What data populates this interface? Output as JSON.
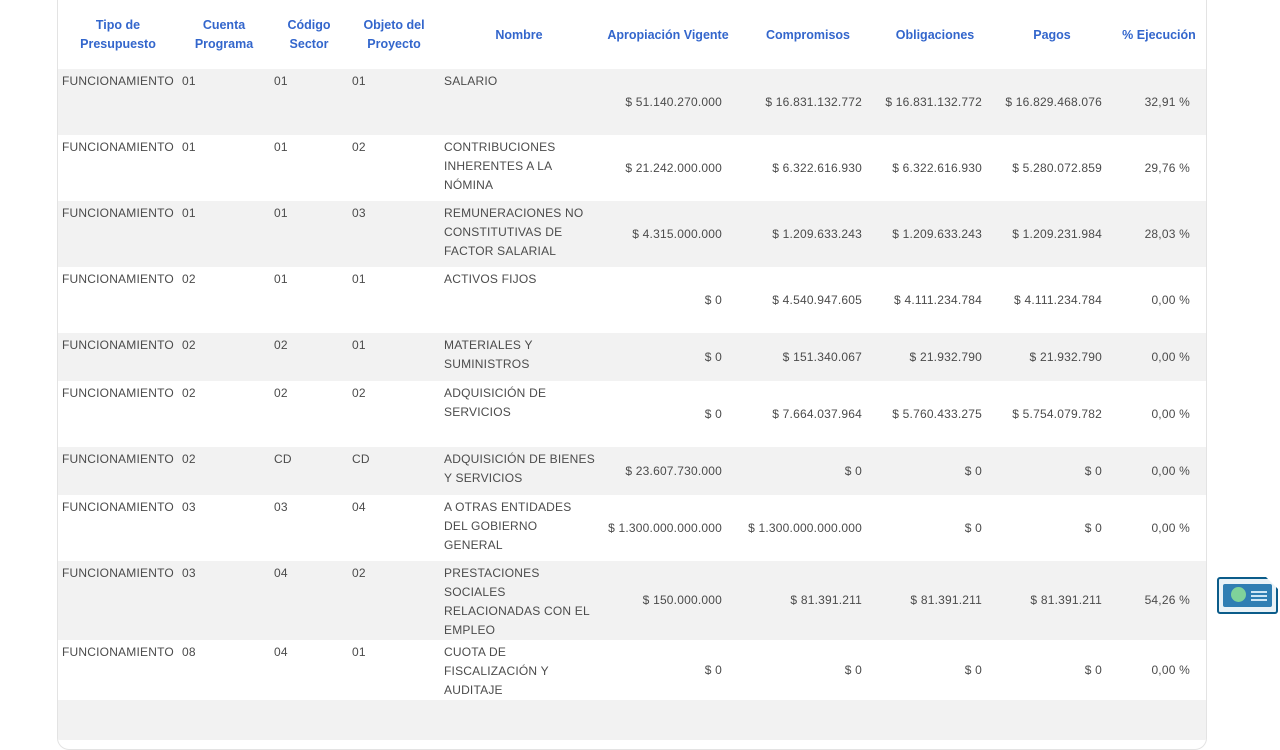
{
  "table": {
    "headers": [
      "Tipo de Presupuesto",
      "Cuenta Programa",
      "Código Sector",
      "Objeto del Proyecto",
      "Nombre",
      "Apropiación Vigente",
      "Compromisos",
      "Obligaciones",
      "Pagos",
      "% Ejecución"
    ],
    "rows": [
      {
        "tipo": "FUNCIONAMIENTO",
        "cuenta": "01",
        "sector": "01",
        "objeto": "01",
        "nombre": "SALARIO",
        "apropiacion": "$ 51.140.270.000",
        "compromisos": "$ 16.831.132.772",
        "obligaciones": "$ 16.831.132.772",
        "pagos": "$ 16.829.468.076",
        "ejecucion": "32,91 %"
      },
      {
        "tipo": "FUNCIONAMIENTO",
        "cuenta": "01",
        "sector": "01",
        "objeto": "02",
        "nombre": "CONTRIBUCIONES INHERENTES A LA NÓMINA",
        "apropiacion": "$ 21.242.000.000",
        "compromisos": "$ 6.322.616.930",
        "obligaciones": "$ 6.322.616.930",
        "pagos": "$ 5.280.072.859",
        "ejecucion": "29,76 %"
      },
      {
        "tipo": "FUNCIONAMIENTO",
        "cuenta": "01",
        "sector": "01",
        "objeto": "03",
        "nombre": "REMUNERACIONES NO CONSTITUTIVAS DE FACTOR SALARIAL",
        "apropiacion": "$ 4.315.000.000",
        "compromisos": "$ 1.209.633.243",
        "obligaciones": "$ 1.209.633.243",
        "pagos": "$ 1.209.231.984",
        "ejecucion": "28,03 %"
      },
      {
        "tipo": "FUNCIONAMIENTO",
        "cuenta": "02",
        "sector": "01",
        "objeto": "01",
        "nombre": "ACTIVOS FIJOS",
        "apropiacion": "$ 0",
        "compromisos": "$ 4.540.947.605",
        "obligaciones": "$ 4.111.234.784",
        "pagos": "$ 4.111.234.784",
        "ejecucion": "0,00 %"
      },
      {
        "tipo": "FUNCIONAMIENTO",
        "cuenta": "02",
        "sector": "02",
        "objeto": "01",
        "nombre": "MATERIALES Y SUMINISTROS",
        "apropiacion": "$ 0",
        "compromisos": "$ 151.340.067",
        "obligaciones": "$ 21.932.790",
        "pagos": "$ 21.932.790",
        "ejecucion": "0,00 %"
      },
      {
        "tipo": "FUNCIONAMIENTO",
        "cuenta": "02",
        "sector": "02",
        "objeto": "02",
        "nombre": "ADQUISICIÓN DE SERVICIOS",
        "apropiacion": "$ 0",
        "compromisos": "$ 7.664.037.964",
        "obligaciones": "$ 5.760.433.275",
        "pagos": "$ 5.754.079.782",
        "ejecucion": "0,00 %"
      },
      {
        "tipo": "FUNCIONAMIENTO",
        "cuenta": "02",
        "sector": "CD",
        "objeto": "CD",
        "nombre": "ADQUISICIÓN DE BIENES Y SERVICIOS",
        "apropiacion": "$ 23.607.730.000",
        "compromisos": "$ 0",
        "obligaciones": "$ 0",
        "pagos": "$ 0",
        "ejecucion": "0,00 %"
      },
      {
        "tipo": "FUNCIONAMIENTO",
        "cuenta": "03",
        "sector": "03",
        "objeto": "04",
        "nombre": "A OTRAS ENTIDADES DEL GOBIERNO GENERAL",
        "apropiacion": "$ 1.300.000.000.000",
        "compromisos": "$ 1.300.000.000.000",
        "obligaciones": "$ 0",
        "pagos": "$ 0",
        "ejecucion": "0,00 %"
      },
      {
        "tipo": "FUNCIONAMIENTO",
        "cuenta": "03",
        "sector": "04",
        "objeto": "02",
        "nombre": "PRESTACIONES SOCIALES RELACIONADAS CON EL EMPLEO",
        "apropiacion": "$ 150.000.000",
        "compromisos": "$ 81.391.211",
        "obligaciones": "$ 81.391.211",
        "pagos": "$ 81.391.211",
        "ejecucion": "54,26 %"
      },
      {
        "tipo": "FUNCIONAMIENTO",
        "cuenta": "08",
        "sector": "04",
        "objeto": "01",
        "nombre": "CUOTA DE FISCALIZACIÓN Y AUDITAJE",
        "apropiacion": "$ 0",
        "compromisos": "$ 0",
        "obligaciones": "$ 0",
        "pagos": "$ 0",
        "ejecucion": "0,00 %"
      }
    ]
  },
  "widgets": {
    "floating_button_icon": "accessibility-widget-icon"
  }
}
